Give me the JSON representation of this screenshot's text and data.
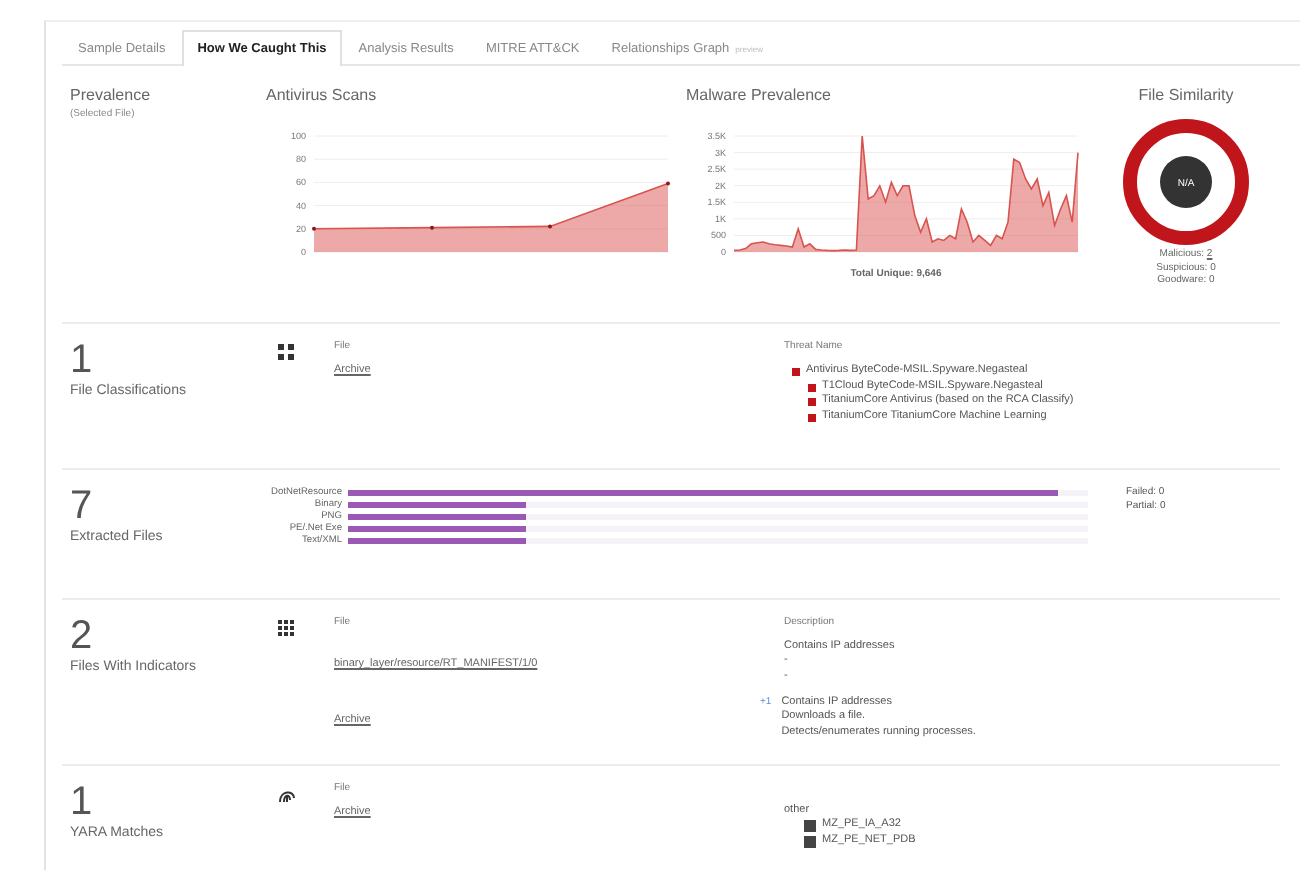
{
  "tabs": [
    {
      "label": "Sample Details",
      "selected": false
    },
    {
      "label": "How We Caught This",
      "selected": true
    },
    {
      "label": "Analysis Results",
      "selected": false
    },
    {
      "label": "MITRE ATT&CK",
      "selected": false
    },
    {
      "label": "Relationships Graph",
      "selected": false,
      "badge": "preview"
    }
  ],
  "prevalence": {
    "title": "Prevalence",
    "subtitle": "(Selected File)"
  },
  "antivirus_scans": {
    "title": "Antivirus Scans",
    "chart_data": {
      "type": "area",
      "grid": true,
      "ylim": [
        0,
        100
      ],
      "yticks": [
        0,
        20,
        40,
        60,
        80,
        100
      ],
      "series": [
        {
          "color": "#d9534f",
          "values": [
            20,
            21,
            22,
            59
          ]
        }
      ]
    }
  },
  "malware_prevalence": {
    "title": "Malware Prevalence",
    "total": "Total Unique: 9,646",
    "chart_data": {
      "type": "area",
      "grid": true,
      "ylim": [
        0,
        3500
      ],
      "yticks": [
        {
          "value": 0,
          "label": "0"
        },
        {
          "value": 500,
          "label": "500"
        },
        {
          "value": 1000,
          "label": "1K"
        },
        {
          "value": 1500,
          "label": "1.5K"
        },
        {
          "value": 2000,
          "label": "2K"
        },
        {
          "value": 2500,
          "label": "2.5K"
        },
        {
          "value": 3000,
          "label": "3K"
        },
        {
          "value": 3500,
          "label": "3.5K"
        }
      ],
      "series": [
        {
          "color": "#d9534f",
          "values": [
            50,
            60,
            100,
            250,
            280,
            300,
            250,
            220,
            200,
            180,
            150,
            700,
            150,
            250,
            80,
            60,
            50,
            40,
            50,
            60,
            50,
            60,
            3500,
            1600,
            1700,
            2000,
            1500,
            2100,
            1700,
            2000,
            2000,
            1100,
            600,
            1000,
            300,
            400,
            350,
            500,
            400,
            1300,
            900,
            300,
            500,
            350,
            200,
            500,
            400,
            900,
            2800,
            2700,
            2200,
            1900,
            2200,
            1400,
            1800,
            800,
            1300,
            1700,
            900,
            3000
          ]
        }
      ]
    }
  },
  "file_similarity": {
    "title": "File Similarity",
    "center": "N/A",
    "counts": [
      {
        "label": "Malicious:",
        "value": "2"
      },
      {
        "label": "Suspicious:",
        "value": "0"
      },
      {
        "label": "Goodware:",
        "value": "0"
      }
    ]
  },
  "file_classifications": {
    "count": "1",
    "label": "File Classifications",
    "file_header": "File",
    "file": "Archive",
    "threat_header": "Threat Name",
    "threats": [
      {
        "name": "Antivirus ByteCode-MSIL.Spyware.Negasteal",
        "children": [
          {
            "name": "T1Cloud ByteCode-MSIL.Spyware.Negasteal"
          },
          {
            "name": "TitaniumCore Antivirus (based on the RCA Classify)"
          },
          {
            "name": "TitaniumCore TitaniumCore Machine Learning"
          }
        ]
      }
    ]
  },
  "extracted_files": {
    "count": "7",
    "label": "Extracted Files",
    "bars": [
      {
        "label": "DotNetResource",
        "level": 0.96
      },
      {
        "label": "Binary",
        "level": 0.24
      },
      {
        "label": "PNG",
        "level": 0.24
      },
      {
        "label": "PE/.Net Exe",
        "level": 0.24
      },
      {
        "label": "Text/XML",
        "level": 0.24
      }
    ],
    "stats": [
      "Failed: 0",
      "Partial: 0"
    ]
  },
  "files_with_indicators": {
    "count": "2",
    "label": "Files With Indicators",
    "file_header": "File",
    "description_header": "Description",
    "rows": [
      {
        "file": "binary_layer/resource/RT_MANIFEST/1/0",
        "lines": [
          "Contains IP addresses",
          "-",
          "-"
        ]
      },
      {
        "file": "Archive",
        "more": "+1",
        "lines": [
          "Contains IP addresses",
          "Downloads a file.",
          "Detects/enumerates running processes."
        ]
      }
    ]
  },
  "yara_matches": {
    "count": "1",
    "label": "YARA Matches",
    "file_header": "File",
    "file": "Archive",
    "group": "other",
    "rules": [
      "MZ_PE_IA_A32",
      "MZ_PE_NET_PDB"
    ]
  }
}
